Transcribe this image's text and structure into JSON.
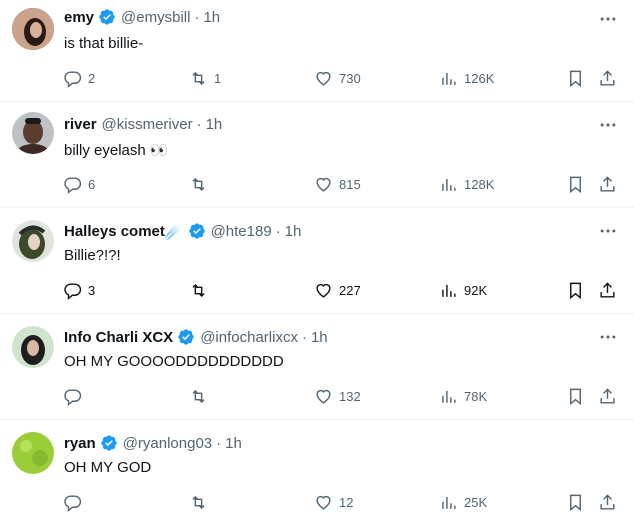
{
  "tweets": [
    {
      "name": "emy",
      "verified": true,
      "handle": "@emysbill",
      "time": "1h",
      "text": "is that billie-",
      "replies": "2",
      "retweets": "1",
      "likes": "730",
      "views": "126K",
      "avatar_color": "#5b3a2e"
    },
    {
      "name": "river",
      "verified": false,
      "handle": "@kissmeriver",
      "time": "1h",
      "text": "billy eyelash 👀",
      "replies": "6",
      "retweets": "",
      "likes": "815",
      "views": "128K",
      "avatar_color": "#4a3b33"
    },
    {
      "name": "Halleys comet☄️",
      "verified": true,
      "handle": "@hte189",
      "time": "1h",
      "text": "Billie?!?!",
      "replies": "3",
      "retweets": "",
      "likes": "227",
      "views": "92K",
      "avatar_color": "#2e3a2a"
    },
    {
      "name": "Info Charli XCX",
      "verified": true,
      "handle": "@infocharlixcx",
      "time": "1h",
      "text": "OH MY GOOOODDDDDDDDDD",
      "replies": "",
      "retweets": "",
      "likes": "132",
      "views": "78K",
      "avatar_color": "#3b4a3a"
    },
    {
      "name": "ryan",
      "verified": true,
      "handle": "@ryanlong03",
      "time": "1h",
      "text": "OH MY GOD",
      "replies": "",
      "retweets": "",
      "likes": "12",
      "views": "25K",
      "avatar_color": "#9bcc3a"
    }
  ],
  "separator": "·",
  "colors": {
    "verified": "#1d9bf0",
    "secondary": "#536471",
    "border": "#eff3f4"
  }
}
